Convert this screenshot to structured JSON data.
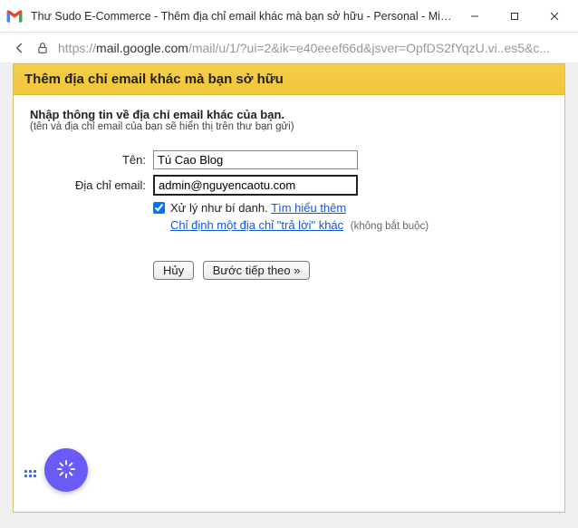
{
  "window": {
    "title": "Thư Sudo E-Commerce - Thêm địa chỉ email khác mà bạn sở hữu - Personal - Micros..."
  },
  "urlbar": {
    "prefix": "https://",
    "host": "mail.google.com",
    "path": "/mail/u/1/?ui=2&ik=e40eeef66d&jsver=OpfDS2fYqzU.vi..es5&c..."
  },
  "header": {
    "title": "Thêm địa chỉ email khác mà bạn sở hữu"
  },
  "instruction": {
    "headline": "Nhập thông tin về địa chỉ email khác của bạn.",
    "subline": "(tên và địa chỉ email của bạn sẽ hiển thị trên thư bạn gửi)"
  },
  "form": {
    "name_label": "Tên:",
    "name_value": "Tú Cao Blog",
    "email_label": "Địa chỉ email:",
    "email_value": "admin@nguyencaotu.com",
    "alias_text": "Xử lý như bí danh.",
    "learn_more": "Tìm hiểu thêm",
    "reply_link": "Chỉ định một địa chỉ \"trả lời\" khác",
    "reply_optional": "(không bắt buộc)"
  },
  "actions": {
    "cancel": "Hủy",
    "next": "Bước tiếp theo »"
  }
}
